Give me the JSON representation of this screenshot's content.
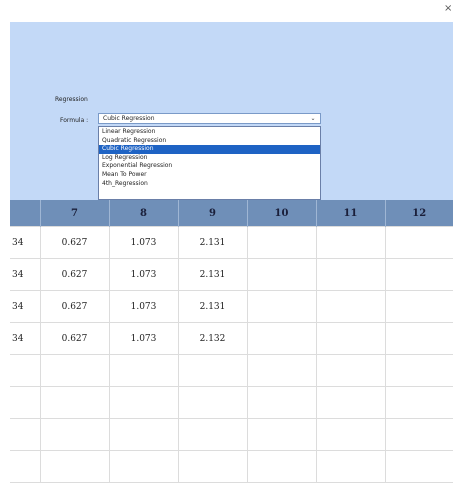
{
  "window": {
    "close_glyph": "×"
  },
  "panel": {
    "regression_label": "Regression",
    "formula_label": "Formula :",
    "combo_value": "Cubic Regression",
    "combo_arrow": "⌄",
    "options": [
      "Linear Regression",
      "Quadratic Regression",
      "Cubic Regression",
      "Log Regression",
      "Exponential Regression",
      "Mean To Power",
      "4th_Regression"
    ],
    "selected_index": 2,
    "colors": {
      "panel_bg": "#c3d9f7",
      "selected_bg": "#1e63c4"
    }
  },
  "table": {
    "headers": [
      "",
      "7",
      "8",
      "9",
      "10",
      "11",
      "12"
    ],
    "rows": [
      [
        "34",
        "0.627",
        "1.073",
        "2.131",
        "",
        "",
        ""
      ],
      [
        "34",
        "0.627",
        "1.073",
        "2.131",
        "",
        "",
        ""
      ],
      [
        "34",
        "0.627",
        "1.073",
        "2.131",
        "",
        "",
        ""
      ],
      [
        "34",
        "0.627",
        "1.073",
        "2.132",
        "",
        "",
        ""
      ],
      [
        "",
        "",
        "",
        "",
        "",
        "",
        ""
      ],
      [
        "",
        "",
        "",
        "",
        "",
        "",
        ""
      ],
      [
        "",
        "",
        "",
        "",
        "",
        "",
        ""
      ],
      [
        "",
        "",
        "",
        "",
        "",
        "",
        ""
      ]
    ],
    "colors": {
      "header_bg": "#6f8fb8"
    }
  }
}
